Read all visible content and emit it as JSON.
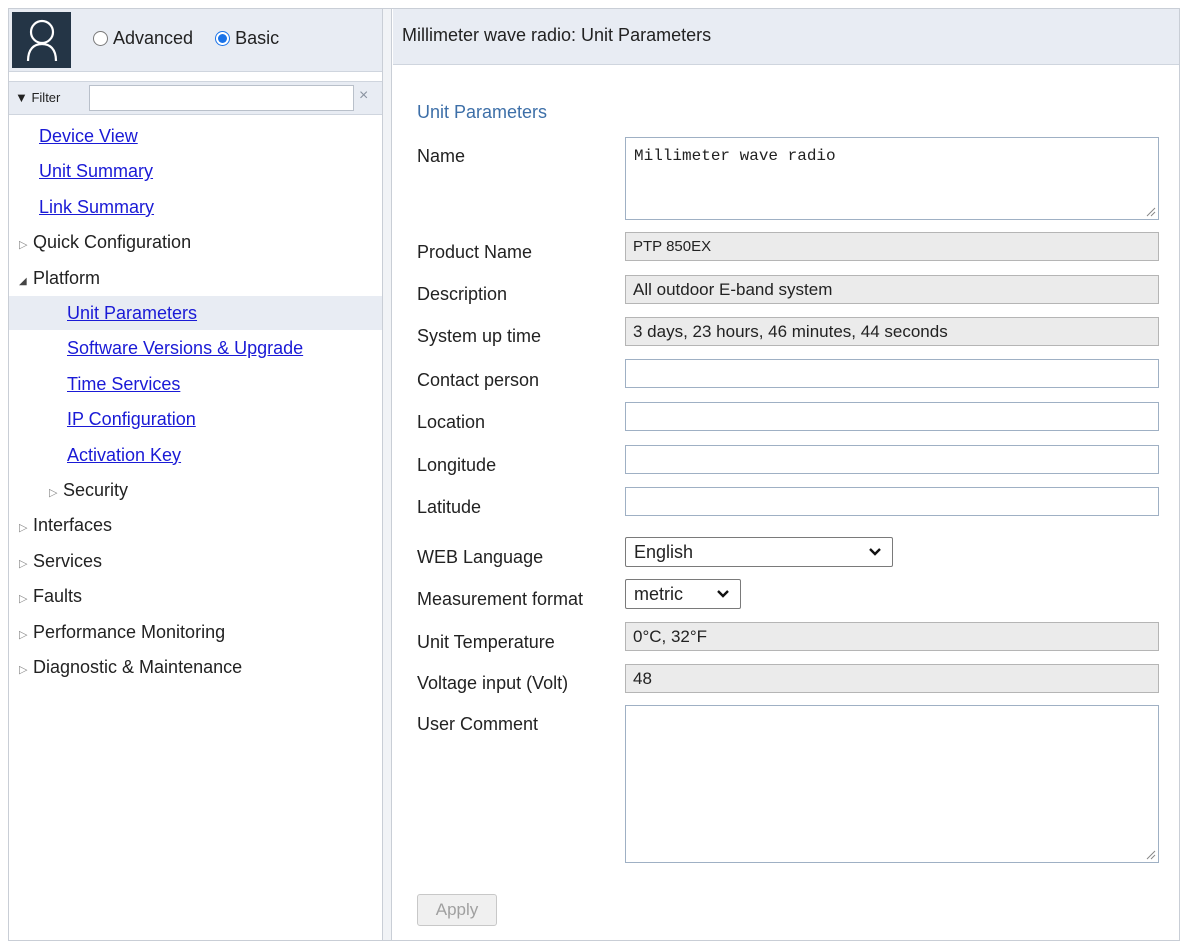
{
  "sidebar": {
    "mode_options": {
      "advanced": "Advanced",
      "basic": "Basic",
      "selected": "Basic"
    },
    "filter": {
      "label": "▼ Filter",
      "value": "",
      "clear_icon": "×"
    },
    "tree": [
      {
        "label": "Device View",
        "type": "link",
        "level": 0
      },
      {
        "label": "Unit Summary",
        "type": "link",
        "level": 0
      },
      {
        "label": "Link Summary",
        "type": "link",
        "level": 0
      },
      {
        "label": "Quick Configuration",
        "type": "folder",
        "level": 0,
        "expanded": false
      },
      {
        "label": "Platform",
        "type": "folder",
        "level": 0,
        "expanded": true
      },
      {
        "label": "Unit Parameters",
        "type": "link",
        "level": 1,
        "selected": true
      },
      {
        "label": "Software Versions & Upgrade",
        "type": "link",
        "level": 1
      },
      {
        "label": "Time Services",
        "type": "link",
        "level": 1
      },
      {
        "label": "IP Configuration",
        "type": "link",
        "level": 1
      },
      {
        "label": "Activation Key",
        "type": "link",
        "level": 1
      },
      {
        "label": "Security",
        "type": "folder",
        "level": 1,
        "expanded": false
      },
      {
        "label": "Interfaces",
        "type": "folder",
        "level": 0,
        "expanded": false
      },
      {
        "label": "Services",
        "type": "folder",
        "level": 0,
        "expanded": false
      },
      {
        "label": "Faults",
        "type": "folder",
        "level": 0,
        "expanded": false
      },
      {
        "label": "Performance Monitoring",
        "type": "folder",
        "level": 0,
        "expanded": false
      },
      {
        "label": "Diagnostic & Maintenance",
        "type": "folder",
        "level": 0,
        "expanded": false
      }
    ]
  },
  "main": {
    "title": "Millimeter wave radio: Unit Parameters",
    "section_title": "Unit Parameters",
    "fields": {
      "name": {
        "label": "Name",
        "value": "Millimeter wave radio"
      },
      "product_name": {
        "label": "Product Name",
        "value": "PTP 850EX"
      },
      "description": {
        "label": "Description",
        "value": "All outdoor E-band system"
      },
      "system_up_time": {
        "label": "System up time",
        "value": "3 days, 23 hours, 46 minutes, 44 seconds"
      },
      "contact_person": {
        "label": "Contact person",
        "value": ""
      },
      "location": {
        "label": "Location",
        "value": ""
      },
      "longitude": {
        "label": "Longitude",
        "value": ""
      },
      "latitude": {
        "label": "Latitude",
        "value": ""
      },
      "web_language": {
        "label": "WEB Language",
        "value": "English"
      },
      "measurement_format": {
        "label": "Measurement format",
        "value": "metric"
      },
      "unit_temperature": {
        "label": "Unit Temperature",
        "value": "0°C, 32°F"
      },
      "voltage_input": {
        "label": "Voltage input (Volt)",
        "value": "48"
      },
      "user_comment": {
        "label": "User Comment",
        "value": ""
      }
    },
    "apply_label": "Apply"
  },
  "colors": {
    "header_bg": "#e8ecf3",
    "avatar_bg": "#243546",
    "link": "#1a1ad6",
    "section_title": "#3d6fa8",
    "radio_selected": "#1a73e8"
  }
}
